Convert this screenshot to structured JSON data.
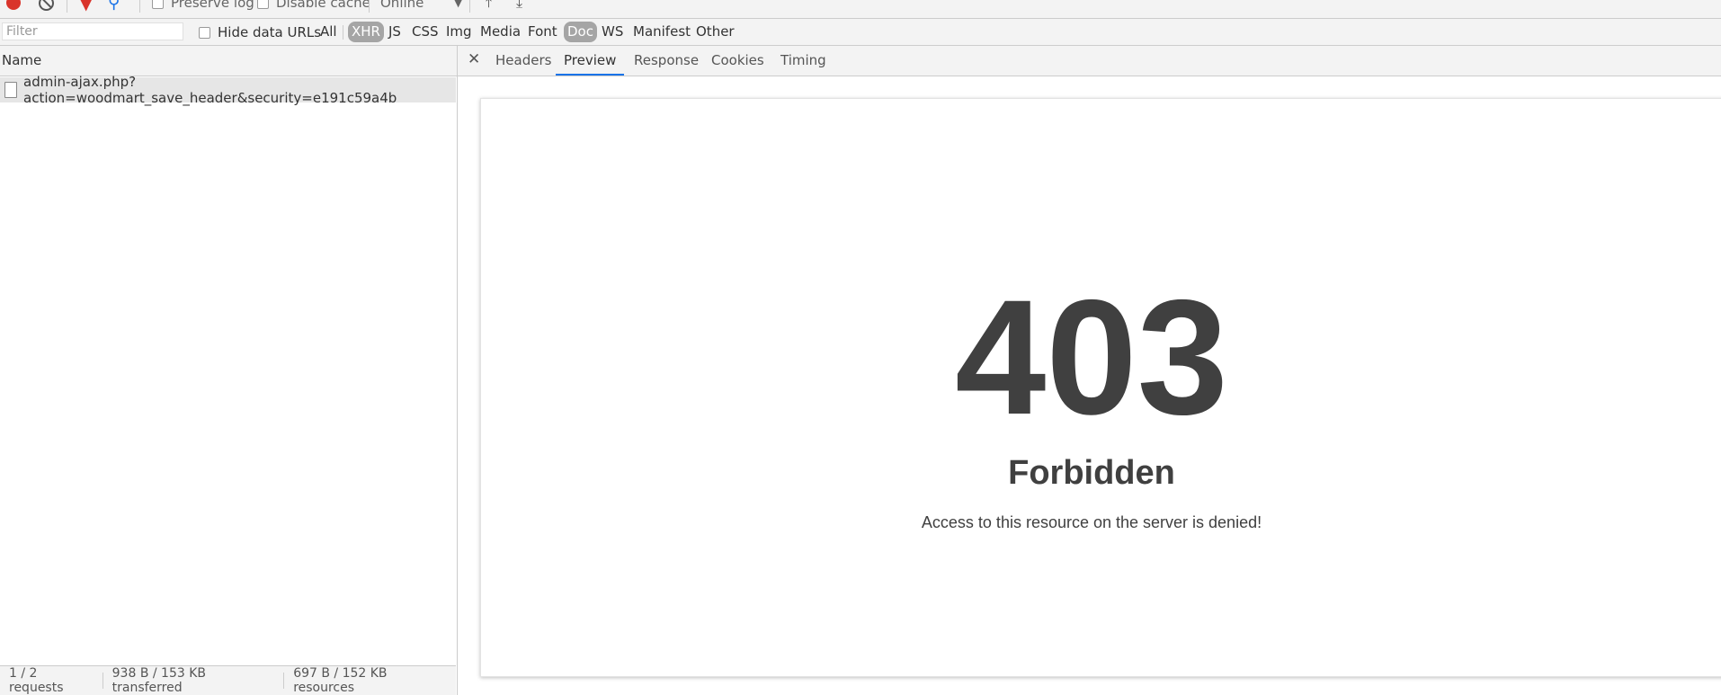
{
  "toolbar": {
    "preserve_log_label": "Preserve log",
    "disable_cache_label": "Disable cache",
    "throttle_value": "Online"
  },
  "filterbar": {
    "filter_placeholder": "Filter",
    "hide_data_urls_label": "Hide data URLs",
    "types": [
      "All",
      "XHR",
      "JS",
      "CSS",
      "Img",
      "Media",
      "Font",
      "Doc",
      "WS",
      "Manifest",
      "Other"
    ],
    "active_types": [
      "XHR",
      "Doc"
    ]
  },
  "requests": {
    "header": "Name",
    "items": [
      {
        "name": "admin-ajax.php?action=woodmart_save_header&security=e191c59a4b"
      }
    ]
  },
  "status": {
    "requests": "1 / 2 requests",
    "transferred": "938 B / 153 KB transferred",
    "resources": "697 B / 152 KB resources"
  },
  "detail": {
    "tabs": [
      "Headers",
      "Preview",
      "Response",
      "Cookies",
      "Timing"
    ],
    "active_tab": "Preview"
  },
  "preview": {
    "code": "403",
    "title": "Forbidden",
    "message": "Access to this resource on the server is denied!"
  },
  "colors": {
    "accent": "#1a73e8",
    "record": "#d9342b",
    "active_type_bg": "#a5a5a5",
    "error_text": "#404040"
  }
}
